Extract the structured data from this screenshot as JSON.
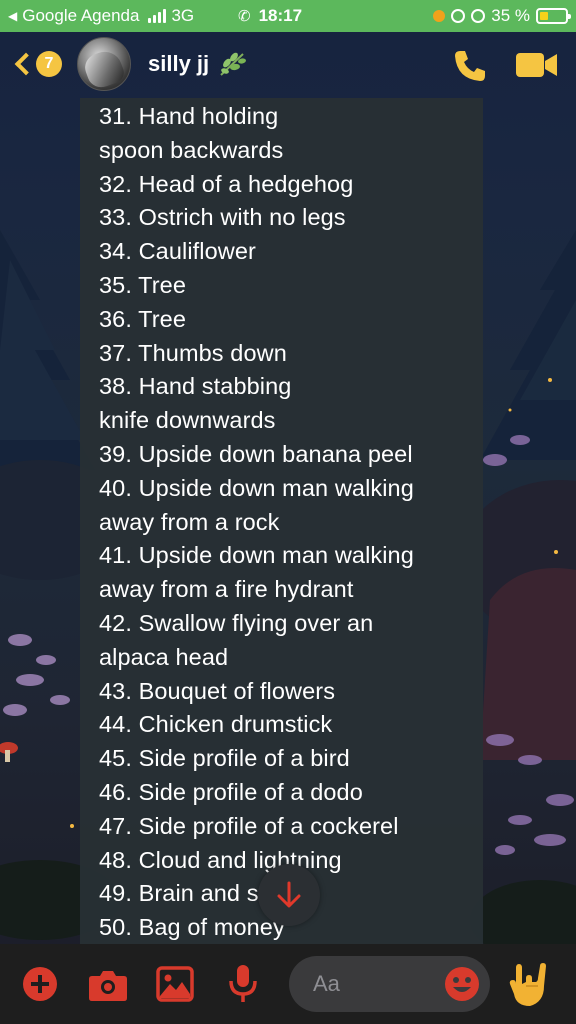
{
  "status_bar": {
    "back_app": "Google Agenda",
    "network": "3G",
    "time": "18:17",
    "battery_percent": "35 %",
    "battery_level": 0.35,
    "colors": {
      "bar": "#5cb85c",
      "battery": "#f5d21a"
    }
  },
  "header": {
    "unread_count": "7",
    "contact_name": "silly jj",
    "name_emoji_icon": "herb-leaf-icon",
    "call_icon": "phone-icon",
    "video_icon": "video-camera-icon",
    "accent_color": "#f5c542"
  },
  "message": {
    "lines": [
      "31. Hand holding",
      "spoon backwards",
      "32. Head of a hedgehog",
      "33. Ostrich with no legs",
      "34. Cauliflower",
      "35. Tree",
      "36. Tree",
      "37. Thumbs down",
      "38. Hand stabbing",
      "knife downwards",
      "39. Upside down banana peel",
      "40. Upside down man walking",
      "away from a rock",
      "41. Upside down man walking",
      "away from a fire hydrant",
      "42. Swallow flying over an",
      "alpaca head",
      "43. Bouquet of flowers",
      "44. Chicken drumstick",
      "45. Side profile of a bird",
      "46. Side profile of a dodo",
      "47. Side profile of a cockerel",
      "48. Cloud and lightning",
      "49. Brain and stem",
      "50. Bag of money"
    ]
  },
  "scroll_down": {
    "icon": "arrow-down-icon"
  },
  "composer": {
    "placeholder": "Aa",
    "icons": [
      "plus-icon",
      "camera-icon",
      "image-icon",
      "microphone-icon",
      "emoji-icon",
      "rock-hand-icon"
    ],
    "accent_color": "#d83a2c"
  }
}
